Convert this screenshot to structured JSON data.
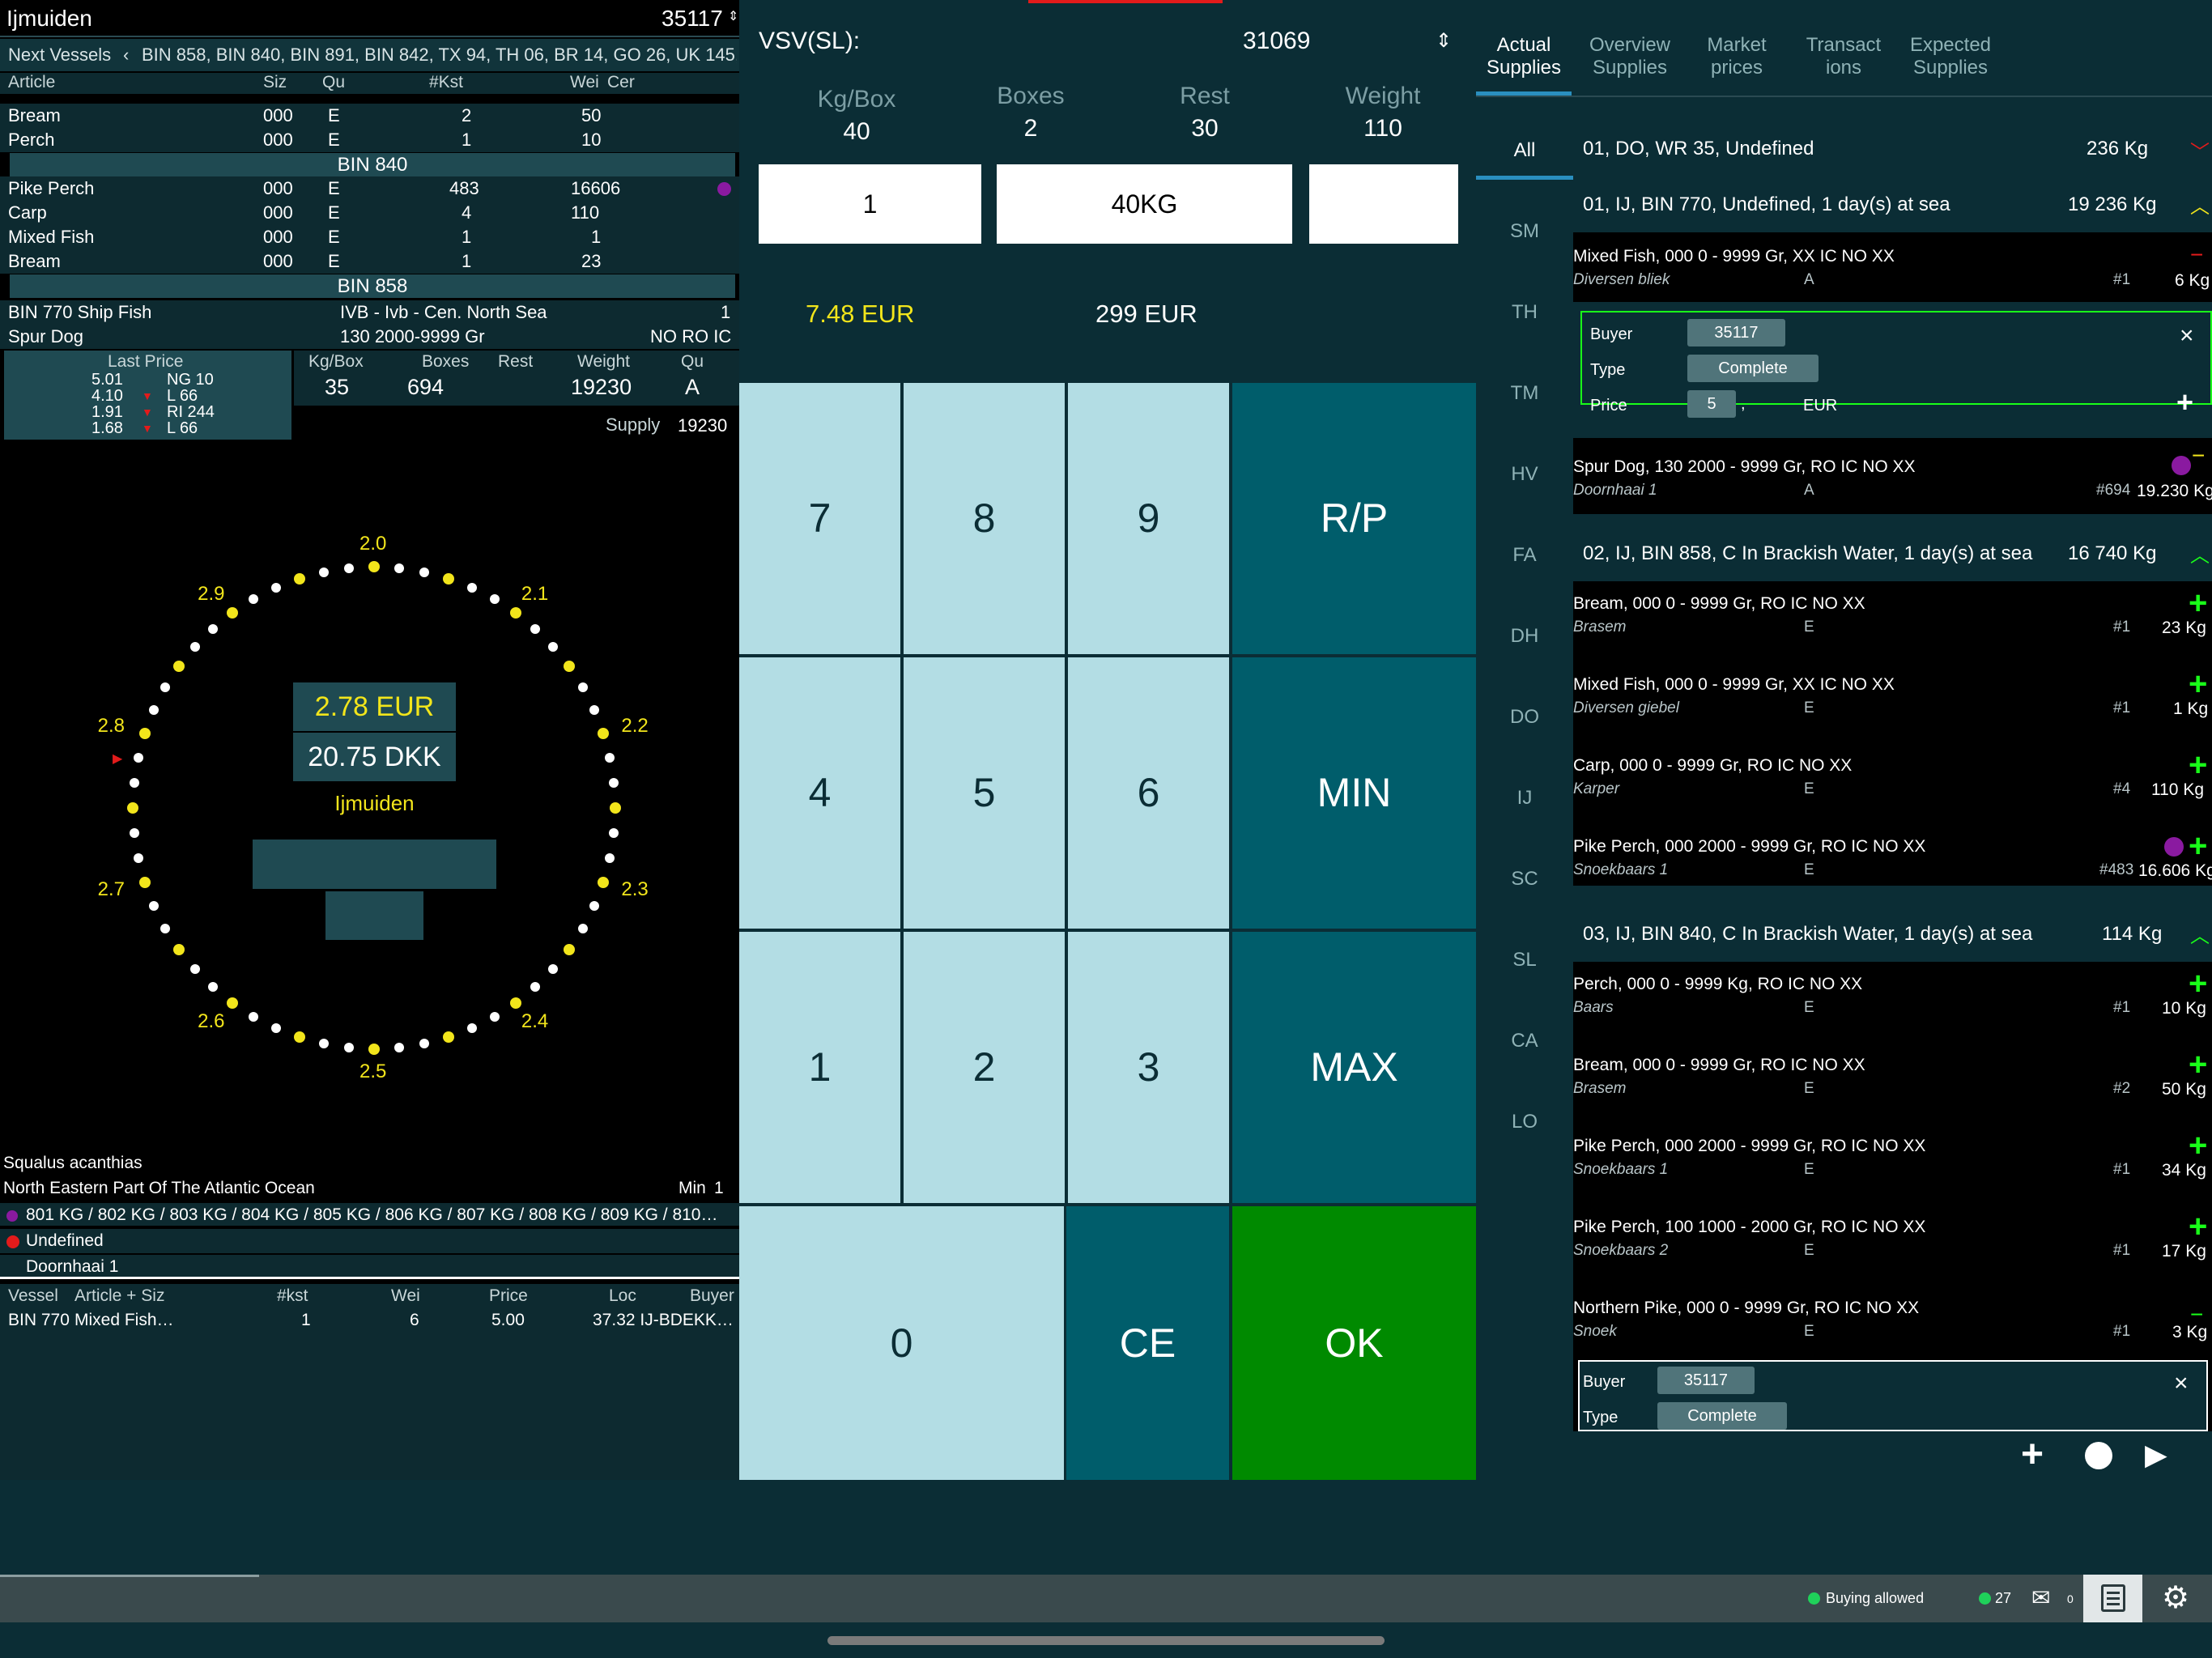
{
  "left": {
    "location": "Ijmuiden",
    "buyer_no": "35117",
    "next_label": "Next Vessels",
    "next_list": "BIN 858, BIN 840, BIN 891, BIN 842, TX 94, TH 06, BR 14, GO 26, UK 145, C",
    "headers": [
      "Article",
      "Siz",
      "Qu",
      "#Kst",
      "Wei",
      "Cer"
    ],
    "top_rows": [
      {
        "a": "Bream",
        "s": "000",
        "q": "E",
        "k": "2",
        "w": "50"
      },
      {
        "a": "Perch",
        "s": "000",
        "q": "E",
        "k": "1",
        "w": "10"
      }
    ],
    "bin840": "BIN 840",
    "mid_rows": [
      {
        "a": "Pike Perch",
        "s": "000",
        "q": "E",
        "k": "483",
        "w": "16606"
      },
      {
        "a": "Carp",
        "s": "000",
        "q": "E",
        "k": "4",
        "w": "110"
      },
      {
        "a": "Mixed Fish",
        "s": "000",
        "q": "E",
        "k": "1",
        "w": "1"
      },
      {
        "a": "Bream",
        "s": "000",
        "q": "E",
        "k": "1",
        "w": "23"
      }
    ],
    "bin858": "BIN 858",
    "lot": {
      "vessel": "BIN 770 Ship Fish",
      "area": "IVB - Ivb - Cen. North Sea",
      "n": "1",
      "fish": "Spur Dog",
      "size": "130 2000-9999 Gr",
      "codes": "NO RO IC"
    },
    "last_price_label": "Last Price",
    "last_prices": [
      {
        "p": "5.01",
        "c": "NG 10",
        "arrow": ""
      },
      {
        "p": "4.10",
        "c": "L 66",
        "arrow": "▼"
      },
      {
        "p": "1.91",
        "c": "RI 244",
        "arrow": "▼"
      },
      {
        "p": "1.68",
        "c": "L 66",
        "arrow": "▼"
      }
    ],
    "stats_headers": [
      "Kg/Box",
      "Boxes",
      "Rest",
      "Weight",
      "Qu"
    ],
    "stats": {
      "kgbox": "35",
      "boxes": "694",
      "rest": "",
      "weight": "19230",
      "qu": "A"
    },
    "supply_label": "Supply",
    "supply_value": "19230",
    "clock_labels": [
      "2.0",
      "2.1",
      "2.2",
      "2.3",
      "2.4",
      "2.5",
      "2.6",
      "2.7",
      "2.8",
      "2.9"
    ],
    "eur": "2.78 EUR",
    "dkk": "20.75 DKK",
    "auction": "Ijmuiden",
    "latin": "Squalus acanthias",
    "fao_area": "North Eastern Part Of The Atlantic Ocean",
    "min_label": "Min",
    "min_value": "1",
    "kgs": "801 KG / 802 KG / 803 KG / 804 KG / 805 KG / 806 KG / 807 KG / 808 KG / 809 KG / 810…",
    "undefined": "Undefined",
    "doornhaai": "Doornhaai 1",
    "sales_headers": [
      "Vessel",
      "Article + Siz",
      "#kst",
      "Wei",
      "Price",
      "Loc",
      "Buyer"
    ],
    "sales": [
      {
        "v": "BIN 770",
        "a": "Mixed Fish…",
        "k": "1",
        "w": "6",
        "p": "5.00",
        "l": "37.32 IJ-BDEKK…"
      }
    ]
  },
  "mid": {
    "title": "VSV(SL):",
    "code": "31069",
    "labels": [
      "Kg/Box",
      "Boxes",
      "Rest",
      "Weight"
    ],
    "values": [
      "40",
      "2",
      "30",
      "110"
    ],
    "input1": "1",
    "input2": "40KG",
    "input3": "",
    "price_kg": "7.48 EUR",
    "price_total": "299 EUR",
    "keys": {
      "k7": "7",
      "k8": "8",
      "k9": "9",
      "rp": "R/P",
      "k4": "4",
      "k5": "5",
      "k6": "6",
      "min": "MIN",
      "k1": "1",
      "k2": "2",
      "k3": "3",
      "max": "MAX",
      "k0": "0",
      "ce": "CE",
      "ok": "OK"
    }
  },
  "right": {
    "tabs": [
      [
        "Actual",
        "Supplies"
      ],
      [
        "Overview",
        "Supplies"
      ],
      [
        "Market",
        "prices"
      ],
      [
        "Transact",
        "ions"
      ],
      [
        "Expected",
        "Supplies"
      ]
    ],
    "cats": [
      "All",
      "SM",
      "TH",
      "TM",
      "HV",
      "FA",
      "DH",
      "DO",
      "IJ",
      "SC",
      "SL",
      "CA",
      "LO"
    ],
    "groups": [
      {
        "t": "01, DO, WR 35, Undefined",
        "kg": "236 Kg"
      },
      {
        "t": "01, IJ, BIN 770, Undefined, 1 day(s) at sea",
        "kg": "19 236 Kg"
      },
      {
        "t": "02, IJ, BIN 858, C In Brackish Water, 1 day(s) at sea",
        "kg": "16 740 Kg"
      },
      {
        "t": "03, IJ, BIN 840, C In Brackish Water, 1 day(s) at sea",
        "kg": "114 Kg"
      }
    ],
    "items": [
      {
        "t": "Mixed Fish, 000 0 - 9999 Gr, XX IC NO XX",
        "s": "Diversen  bliek",
        "q": "A",
        "n": "#1",
        "kg": "6 Kg",
        "sign": "−"
      },
      {
        "t": "Spur Dog, 130 2000 - 9999 Gr, RO IC NO XX",
        "s": "Doornhaai 1",
        "q": "A",
        "n": "#694",
        "kg": "19.230 Kg",
        "sign": "−"
      },
      {
        "t": "Bream, 000 0 - 9999 Gr, RO IC NO XX",
        "s": "Brasem",
        "q": "E",
        "n": "#1",
        "kg": "23 Kg",
        "sign": "+"
      },
      {
        "t": "Mixed Fish, 000 0 - 9999 Gr, XX IC NO XX",
        "s": "Diversen  giebel",
        "q": "E",
        "n": "#1",
        "kg": "1 Kg",
        "sign": "+"
      },
      {
        "t": "Carp, 000 0 - 9999 Gr, RO IC NO XX",
        "s": "Karper",
        "q": "E",
        "n": "#4",
        "kg": "110 Kg",
        "sign": "+"
      },
      {
        "t": "Pike Perch, 000 2000 - 9999 Gr, RO IC NO XX",
        "s": "Snoekbaars 1",
        "q": "E",
        "n": "#483",
        "kg": "16.606 Kg",
        "sign": "+"
      },
      {
        "t": "Perch, 000 0 - 9999 Kg, RO IC NO XX",
        "s": "Baars",
        "q": "E",
        "n": "#1",
        "kg": "10 Kg",
        "sign": "+"
      },
      {
        "t": "Bream, 000 0 - 9999 Gr, RO IC NO XX",
        "s": "Brasem",
        "q": "E",
        "n": "#2",
        "kg": "50 Kg",
        "sign": "+"
      },
      {
        "t": "Pike Perch, 000 2000 - 9999 Gr, RO IC NO XX",
        "s": "Snoekbaars 1",
        "q": "E",
        "n": "#1",
        "kg": "34 Kg",
        "sign": "+"
      },
      {
        "t": "Pike Perch, 100 1000 - 2000 Gr, RO IC NO XX",
        "s": "Snoekbaars 2",
        "q": "E",
        "n": "#1",
        "kg": "17 Kg",
        "sign": "+"
      },
      {
        "t": "Northern Pike, 000 0 - 9999 Gr, RO IC NO XX",
        "s": "Snoek",
        "q": "E",
        "n": "#1",
        "kg": "3 Kg",
        "sign": "−"
      }
    ],
    "bid": {
      "buyer_label": "Buyer",
      "buyer": "35117",
      "type_label": "Type",
      "type": "Complete",
      "price_label": "Price",
      "price_int": "5",
      "price_dec": "",
      "cur": "EUR",
      "close": "×",
      "plus": "+"
    }
  },
  "status": {
    "buying": "Buying allowed",
    "count": "27",
    "mail": "0"
  },
  "colors": {
    "bg": "#0b2d35",
    "band": "#1f4a52",
    "key_light": "#b3dde4",
    "key_dark": "#005d6b",
    "ok": "#008a00",
    "yellow": "#f2e51b",
    "green": "#19ff19",
    "accent": "#2a8fbf"
  }
}
